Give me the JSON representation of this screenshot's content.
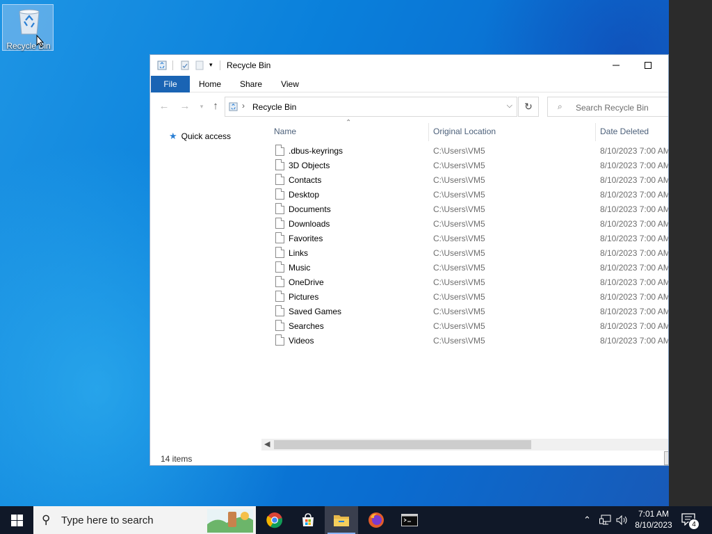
{
  "desktop": {
    "icons": [
      {
        "label": "Recycle Bin",
        "icon": "recycle-bin-icon"
      }
    ]
  },
  "window": {
    "title": "Recycle Bin",
    "ribbon_tabs": [
      "File",
      "Home",
      "Share",
      "View"
    ],
    "address": {
      "crumb": "Recycle Bin"
    },
    "search": {
      "placeholder": "Search Recycle Bin"
    },
    "nav_pane": {
      "quick_access": "Quick access"
    },
    "columns": {
      "name": "Name",
      "location": "Original Location",
      "date": "Date Deleted"
    },
    "files": [
      {
        "name": ".dbus-keyrings",
        "location": "C:\\Users\\VM5",
        "date": "8/10/2023 7:00 AM"
      },
      {
        "name": "3D Objects",
        "location": "C:\\Users\\VM5",
        "date": "8/10/2023 7:00 AM"
      },
      {
        "name": "Contacts",
        "location": "C:\\Users\\VM5",
        "date": "8/10/2023 7:00 AM"
      },
      {
        "name": "Desktop",
        "location": "C:\\Users\\VM5",
        "date": "8/10/2023 7:00 AM"
      },
      {
        "name": "Documents",
        "location": "C:\\Users\\VM5",
        "date": "8/10/2023 7:00 AM"
      },
      {
        "name": "Downloads",
        "location": "C:\\Users\\VM5",
        "date": "8/10/2023 7:00 AM"
      },
      {
        "name": "Favorites",
        "location": "C:\\Users\\VM5",
        "date": "8/10/2023 7:00 AM"
      },
      {
        "name": "Links",
        "location": "C:\\Users\\VM5",
        "date": "8/10/2023 7:00 AM"
      },
      {
        "name": "Music",
        "location": "C:\\Users\\VM5",
        "date": "8/10/2023 7:00 AM"
      },
      {
        "name": "OneDrive",
        "location": "C:\\Users\\VM5",
        "date": "8/10/2023 7:00 AM"
      },
      {
        "name": "Pictures",
        "location": "C:\\Users\\VM5",
        "date": "8/10/2023 7:00 AM"
      },
      {
        "name": "Saved Games",
        "location": "C:\\Users\\VM5",
        "date": "8/10/2023 7:00 AM"
      },
      {
        "name": "Searches",
        "location": "C:\\Users\\VM5",
        "date": "8/10/2023 7:00 AM"
      },
      {
        "name": "Videos",
        "location": "C:\\Users\\VM5",
        "date": "8/10/2023 7:00 AM"
      }
    ],
    "status": "14 items"
  },
  "taskbar": {
    "search_placeholder": "Type here to search",
    "apps": [
      "chrome-icon",
      "store-icon",
      "file-explorer-icon",
      "firefox-icon",
      "terminal-icon"
    ],
    "clock": {
      "time": "7:01 AM",
      "date": "8/10/2023"
    },
    "notification_count": "4"
  },
  "colors": {
    "accent": "#1a64b4",
    "taskbar": "#101828"
  }
}
